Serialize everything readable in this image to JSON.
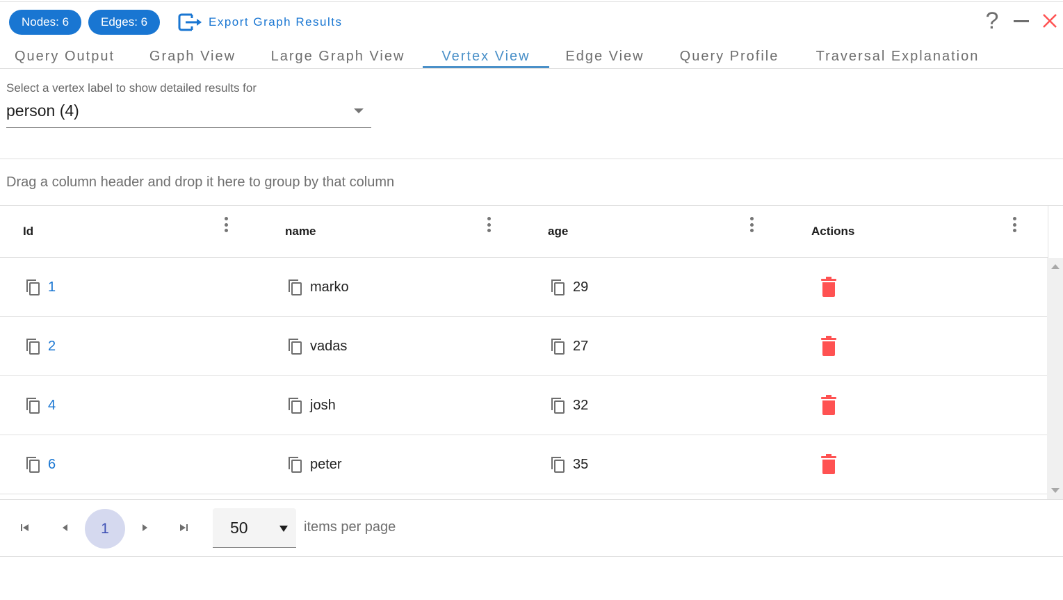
{
  "header": {
    "nodes_chip": "Nodes: 6",
    "edges_chip": "Edges: 6",
    "export_label": "Export Graph Results",
    "help_glyph": "?"
  },
  "tabs": [
    {
      "label": "Query Output",
      "active": false
    },
    {
      "label": "Graph View",
      "active": false
    },
    {
      "label": "Large Graph View",
      "active": false
    },
    {
      "label": "Vertex View",
      "active": true
    },
    {
      "label": "Edge View",
      "active": false
    },
    {
      "label": "Query Profile",
      "active": false
    },
    {
      "label": "Traversal Explanation",
      "active": false
    }
  ],
  "vertex_select": {
    "label": "Select a vertex label to show detailed results for",
    "value": "person (4)"
  },
  "grid": {
    "group_panel_hint": "Drag a column header and drop it here to group by that column",
    "columns": [
      "Id",
      "name",
      "age",
      "Actions"
    ],
    "rows": [
      {
        "id": "1",
        "name": "marko",
        "age": "29"
      },
      {
        "id": "2",
        "name": "vadas",
        "age": "27"
      },
      {
        "id": "4",
        "name": "josh",
        "age": "32"
      },
      {
        "id": "6",
        "name": "peter",
        "age": "35"
      }
    ]
  },
  "pager": {
    "current_page": "1",
    "page_size": "50",
    "per_page_label": "items per page"
  },
  "colors": {
    "accent": "#1976d2",
    "active_tab": "#4a90c8",
    "delete": "#ff5252",
    "close": "#ff5252"
  }
}
